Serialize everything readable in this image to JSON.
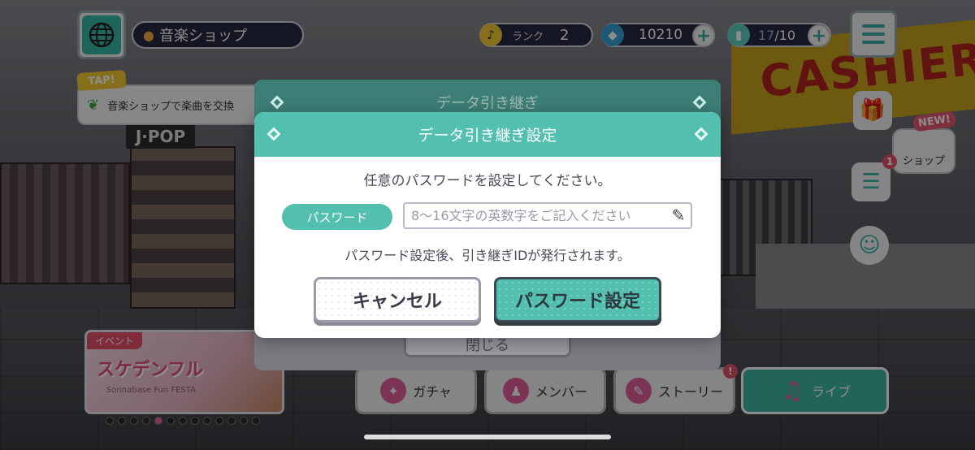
{
  "hud": {
    "location": "音楽ショップ",
    "rank_label": "ランク",
    "rank_value": "2",
    "gems": "10210",
    "lp_current": "17",
    "lp_max": "/10"
  },
  "mission": {
    "tap_tag": "TAP!",
    "text": "音楽ショップで楽曲を交換"
  },
  "side": {
    "new_tag": "NEW!",
    "shop_label": "ショップ",
    "notif_count": "1"
  },
  "event": {
    "tag": "イベント",
    "title": "スケデンフル",
    "subtitle": "Sonnabase Fun FESTA"
  },
  "nav": {
    "gacha": "ガチャ",
    "member": "メンバー",
    "story": "ストーリー",
    "story_badge": "!",
    "live": "ライブ"
  },
  "back_dialog": {
    "title": "データ引き継ぎ",
    "close": "閉じる"
  },
  "dialog": {
    "title": "データ引き継ぎ設定",
    "prompt": "任意のパスワードを設定してください。",
    "password_label": "パスワード",
    "password_placeholder": "8〜16文字の英数字をご記入ください",
    "password_value": "",
    "note": "パスワード設定後、引き継ぎIDが発行されます。",
    "cancel": "キャンセル",
    "confirm": "パスワード設定"
  },
  "colors": {
    "accent": "#52bfaf",
    "pink": "#e6506a"
  }
}
